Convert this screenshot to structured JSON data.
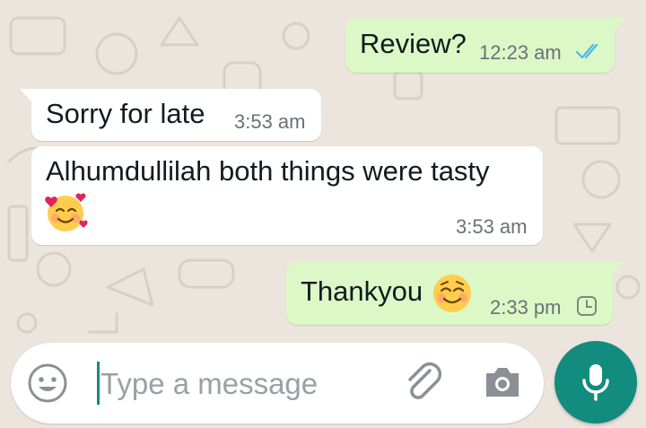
{
  "chat": {
    "messages": [
      {
        "direction": "outgoing",
        "text": "Review?",
        "time": "12:23 am",
        "status": "read"
      },
      {
        "direction": "incoming",
        "text": "Sorry for late",
        "time": "3:53 am"
      },
      {
        "direction": "incoming",
        "text": "Alhumdullilah  both things  were tasty",
        "emoji": "smiling-face-with-hearts",
        "time": "3:53 am"
      },
      {
        "direction": "outgoing",
        "text": "Thankyou",
        "emoji": "smiling-face-blushing",
        "time": "2:33 pm",
        "status": "pending"
      }
    ]
  },
  "input": {
    "placeholder": "Type a message",
    "icons": [
      "emoji-icon",
      "attach-icon",
      "camera-icon",
      "mic-icon"
    ]
  },
  "colors": {
    "background": "#ece5dd",
    "outgoing_bubble": "#dcf8c6",
    "incoming_bubble": "#ffffff",
    "read_ticks": "#4fb6ec",
    "accent": "#128c7e"
  }
}
